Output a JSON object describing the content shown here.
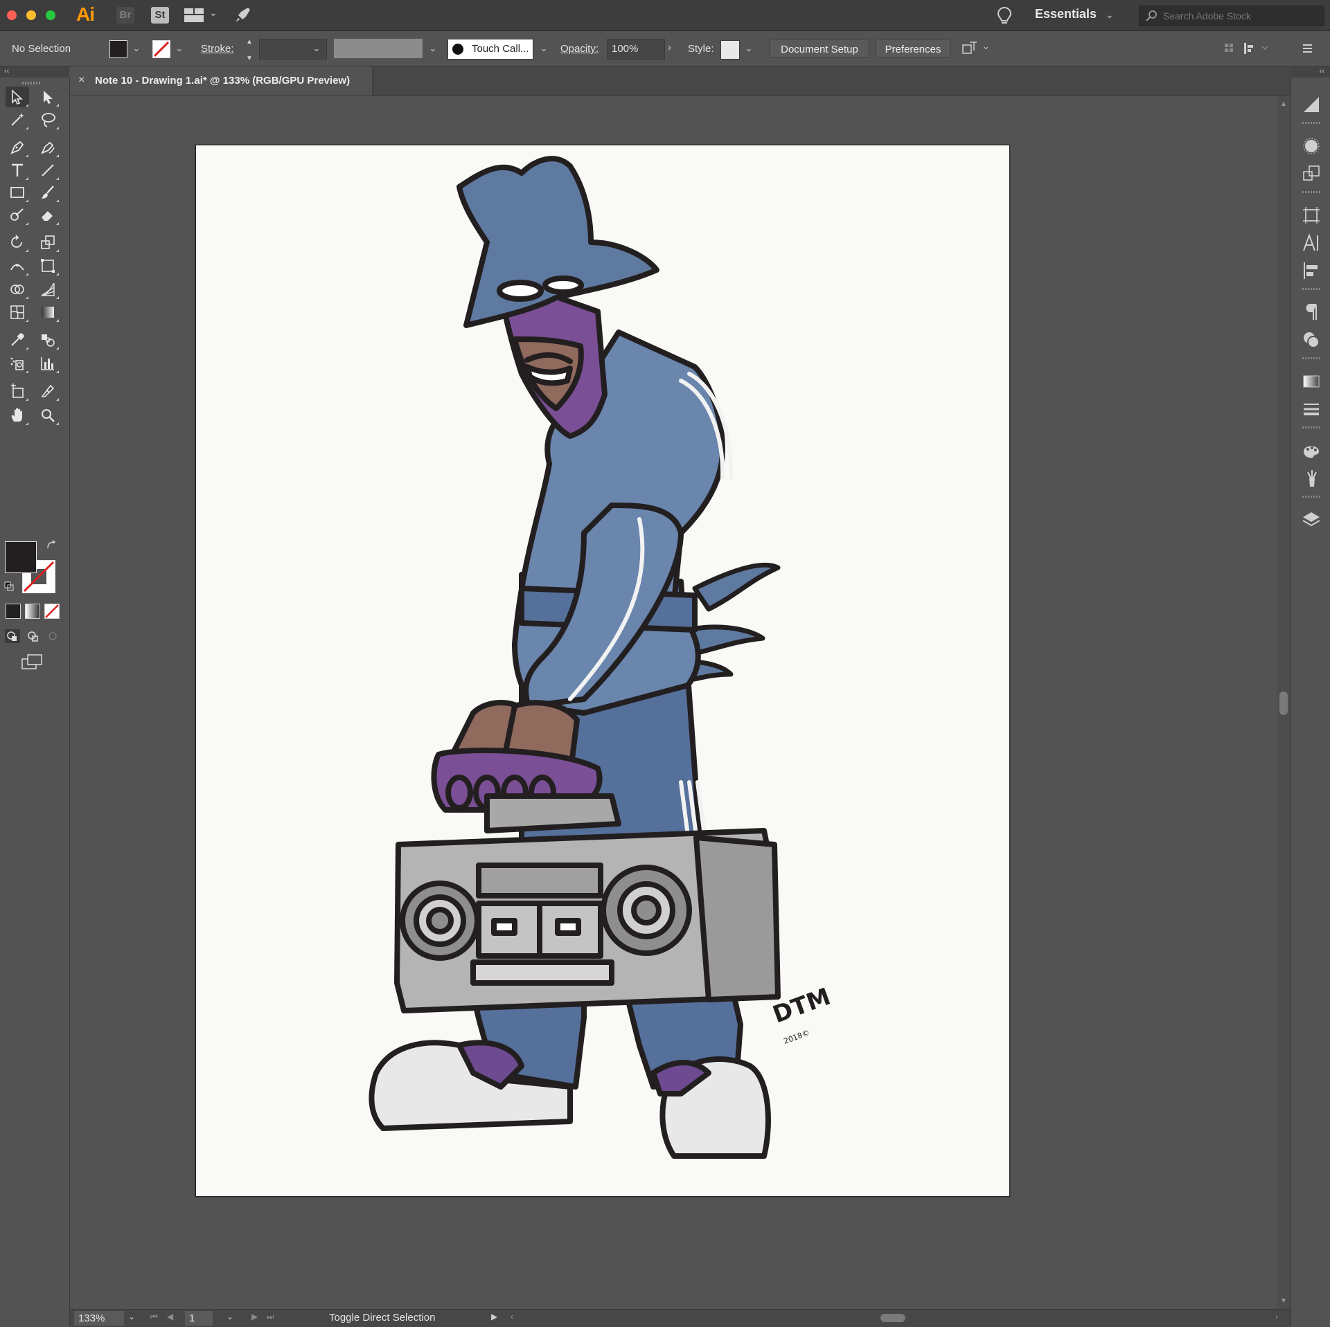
{
  "app": {
    "logo": "Ai",
    "bridge": "Br",
    "stock": "St",
    "workspace": "Essentials",
    "search_placeholder": "Search Adobe Stock"
  },
  "controlbar": {
    "selection": "No Selection",
    "stroke_label": "Stroke:",
    "brush": "Touch Call...",
    "opacity_label": "Opacity:",
    "opacity_value": "100%",
    "style_label": "Style:",
    "document_setup": "Document Setup",
    "preferences": "Preferences",
    "fill_color": "#231f20"
  },
  "document": {
    "tab_close": "×",
    "tab_title": "Note 10 - Drawing 1.ai* @ 133% (RGB/GPU Preview)"
  },
  "artwork": {
    "signature": "DTM",
    "signature_year": "2018©"
  },
  "status": {
    "zoom": "133%",
    "page": "1",
    "message": "Toggle Direct Selection"
  },
  "icons": {
    "tools": [
      "selection-tool",
      "direct-selection-tool",
      "magic-wand-tool",
      "lasso-tool",
      "pen-tool",
      "curvature-tool",
      "type-tool",
      "line-segment-tool",
      "rectangle-tool",
      "paintbrush-tool",
      "shaper-tool",
      "eraser-tool",
      "rotate-tool",
      "scale-tool",
      "width-tool",
      "free-transform-tool",
      "shape-builder-tool",
      "perspective-grid-tool",
      "mesh-tool",
      "gradient-tool",
      "eyedropper-tool",
      "blend-tool",
      "symbol-sprayer-tool",
      "column-graph-tool",
      "artboard-tool",
      "slice-tool",
      "hand-tool",
      "zoom-tool"
    ],
    "dock": [
      "color-guide-icon",
      "appearance-icon",
      "transform-icon",
      "artboards-icon",
      "character-icon",
      "align-icon",
      "paragraph-icon",
      "pathfinder-icon",
      "gradient-panel-icon",
      "stroke-panel-icon",
      "swatches-icon",
      "brushes-icon",
      "layers-icon"
    ]
  }
}
